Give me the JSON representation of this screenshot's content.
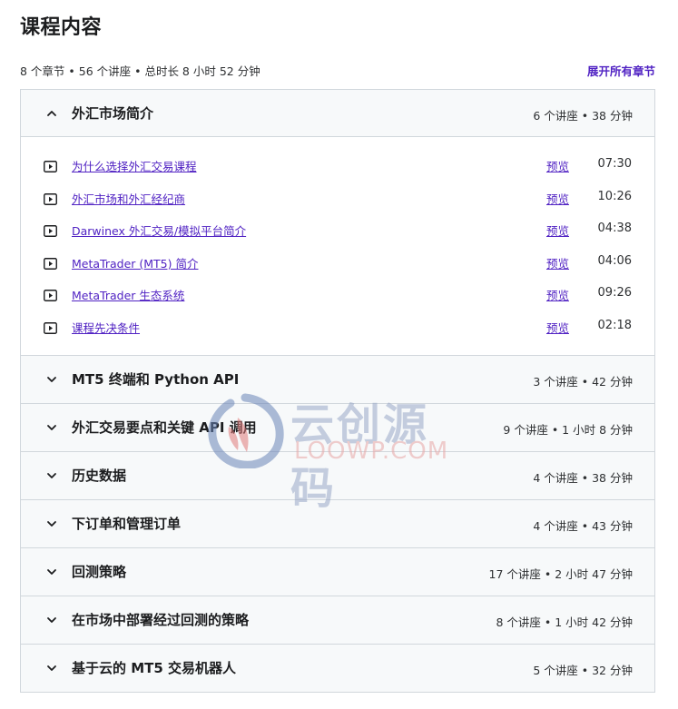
{
  "header": {
    "title": "课程内容",
    "summary": "8 个章节 • 56 个讲座 • 总时长 8 小时 52 分钟",
    "expand_all": "展开所有章节"
  },
  "sections": [
    {
      "title": "外汇市场简介",
      "meta": "6 个讲座 • 38 分钟",
      "expanded": true,
      "lectures": [
        {
          "title": "为什么选择外汇交易课程",
          "preview": "预览",
          "duration": "07:30"
        },
        {
          "title": "外汇市场和外汇经纪商",
          "preview": "预览",
          "duration": "10:26"
        },
        {
          "title": "Darwinex 外汇交易/模拟平台简介",
          "preview": "预览",
          "duration": "04:38"
        },
        {
          "title": "MetaTrader (MT5) 简介",
          "preview": "预览",
          "duration": "04:06"
        },
        {
          "title": "MetaTrader 生态系统",
          "preview": "预览",
          "duration": "09:26"
        },
        {
          "title": "课程先决条件",
          "preview": "预览",
          "duration": "02:18"
        }
      ]
    },
    {
      "title": "MT5 终端和 Python API",
      "meta": "3 个讲座 • 42 分钟",
      "expanded": false
    },
    {
      "title": "外汇交易要点和关键 API 调用",
      "meta": "9 个讲座 • 1 小时 8 分钟",
      "expanded": false
    },
    {
      "title": "历史数据",
      "meta": "4 个讲座 • 38 分钟",
      "expanded": false
    },
    {
      "title": "下订单和管理订单",
      "meta": "4 个讲座 • 43 分钟",
      "expanded": false
    },
    {
      "title": "回测策略",
      "meta": "17 个讲座 • 2 小时 47 分钟",
      "expanded": false
    },
    {
      "title": "在市场中部署经过回测的策略",
      "meta": "8 个讲座 • 1 小时 42 分钟",
      "expanded": false
    },
    {
      "title": "基于云的 MT5 交易机器人",
      "meta": "5 个讲座 • 32 分钟",
      "expanded": false
    }
  ],
  "watermark": {
    "cn": "云创源码",
    "en": "LOOWP.COM"
  },
  "icons": {
    "expanded": "chevron-up-icon",
    "collapsed": "chevron-down-icon",
    "lecture": "play-video-icon"
  },
  "colors": {
    "link": "#5022c3",
    "header_bg": "#f7f9fa",
    "border": "#d1d7dc",
    "text": "#1c1d1f"
  }
}
